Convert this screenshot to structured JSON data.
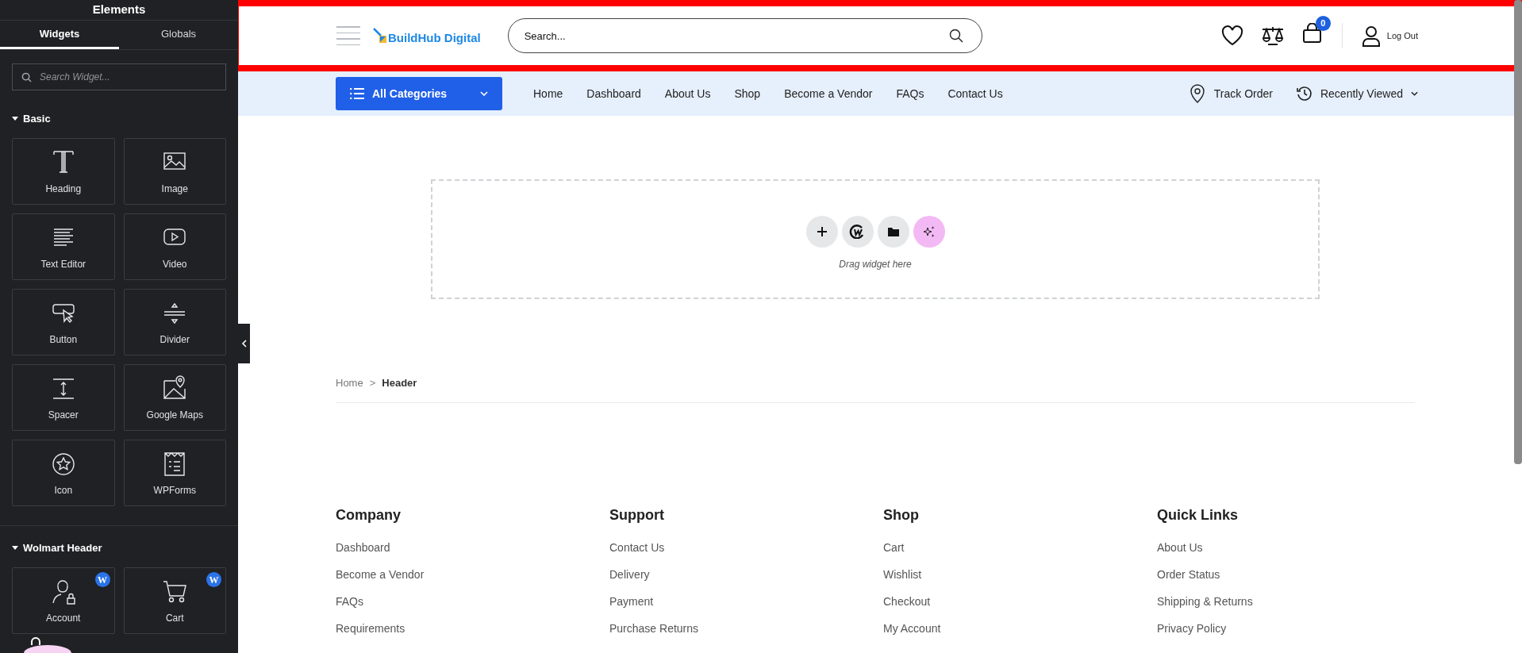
{
  "panel": {
    "title": "Elements",
    "tabs": [
      {
        "label": "Widgets",
        "selected": true
      },
      {
        "label": "Globals",
        "selected": false
      }
    ],
    "search": {
      "placeholder": "Search Widget..."
    },
    "sections": [
      {
        "title": "Basic",
        "expanded": true,
        "widgets": [
          {
            "label": "Heading",
            "kind": "heading"
          },
          {
            "label": "Image",
            "kind": "image"
          },
          {
            "label": "Text Editor",
            "kind": "text"
          },
          {
            "label": "Video",
            "kind": "video"
          },
          {
            "label": "Button",
            "kind": "button"
          },
          {
            "label": "Divider",
            "kind": "divider"
          },
          {
            "label": "Spacer",
            "kind": "spacer"
          },
          {
            "label": "Google Maps",
            "kind": "map"
          },
          {
            "label": "Icon",
            "kind": "icon"
          },
          {
            "label": "WPForms",
            "kind": "form"
          }
        ]
      },
      {
        "title": "Wolmart Header",
        "expanded": true,
        "widgets": [
          {
            "label": "Account",
            "kind": "account",
            "badge": "W"
          },
          {
            "label": "Cart",
            "kind": "cart",
            "badge": "W"
          }
        ]
      }
    ]
  },
  "header": {
    "selected": true,
    "logo": "BuildHub Digital",
    "search": {
      "placeholder": "Search..."
    },
    "cart_count": "0",
    "account_label": "Log Out"
  },
  "nav": {
    "categories_button": "All Categories",
    "links": [
      "Home",
      "Dashboard",
      "About Us",
      "Shop",
      "Become a Vendor",
      "FAQs",
      "Contact Us"
    ],
    "track_order": "Track Order",
    "recently_viewed": "Recently Viewed"
  },
  "drop_zone": {
    "hint": "Drag widget here"
  },
  "breadcrumb": {
    "separator": ">",
    "items": [
      {
        "label": "Home",
        "current": false
      },
      {
        "label": "Header",
        "current": true
      }
    ]
  },
  "footer": {
    "columns": [
      {
        "title": "Company",
        "links": [
          "Dashboard",
          "Become a Vendor",
          "FAQs",
          "Requirements"
        ]
      },
      {
        "title": "Support",
        "links": [
          "Contact Us",
          "Delivery",
          "Payment",
          "Purchase Returns"
        ]
      },
      {
        "title": "Shop",
        "links": [
          "Cart",
          "Wishlist",
          "Checkout",
          "My Account"
        ]
      },
      {
        "title": "Quick Links",
        "links": [
          "About Us",
          "Order Status",
          "Shipping & Returns",
          "Privacy Policy"
        ]
      }
    ]
  }
}
